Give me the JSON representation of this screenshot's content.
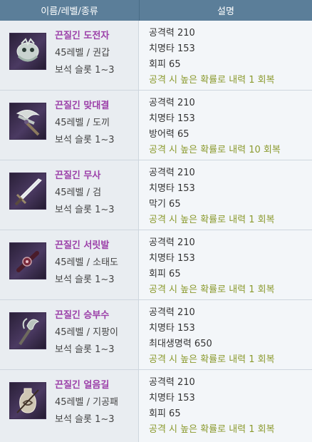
{
  "header": {
    "col_item": "이름/레벨/종류",
    "col_desc": "설명"
  },
  "items": [
    {
      "name": "끈질긴 도전자",
      "level_type": "45레벨 / 권갑",
      "slots": "보석 슬롯 1~3",
      "stats": [
        "공격력 210",
        "치명타 153",
        "회피 65"
      ],
      "effect": "공격 시 높은 확률로 내력 1 회복",
      "icon": "gauntlet-icon"
    },
    {
      "name": "끈질긴 맞대결",
      "level_type": "45레벨 / 도끼",
      "slots": "보석 슬롯 1~3",
      "stats": [
        "공격력 210",
        "치명타 153",
        "방어력 65"
      ],
      "effect": "공격 시 높은 확률로 내력 10 회복",
      "icon": "axe-icon"
    },
    {
      "name": "끈질긴 무사",
      "level_type": "45레벨 / 검",
      "slots": "보석 슬롯 1~3",
      "stats": [
        "공격력 210",
        "치명타 153",
        "막기 65"
      ],
      "effect": "공격 시 높은 확률로 내력 1 회복",
      "icon": "sword-icon"
    },
    {
      "name": "끈질긴 서릿발",
      "level_type": "45레벨 / 소태도",
      "slots": "보석 슬롯 1~3",
      "stats": [
        "공격력 210",
        "치명타 153",
        "회피 65"
      ],
      "effect": "공격 시 높은 확률로 내력 1 회복",
      "icon": "dagger-icon"
    },
    {
      "name": "끈질긴 승부수",
      "level_type": "45레벨 / 지팡이",
      "slots": "보석 슬롯 1~3",
      "stats": [
        "공격력 210",
        "치명타 153",
        "최대생명력 650"
      ],
      "effect": "공격 시 높은 확률로 내력 1 회복",
      "icon": "staff-icon"
    },
    {
      "name": "끈질긴 얼음길",
      "level_type": "45레벨 / 기공패",
      "slots": "보석 슬롯 1~3",
      "stats": [
        "공격력 210",
        "치명타 153",
        "회피 65"
      ],
      "effect": "공격 시 높은 확률로 내력 1 회복",
      "icon": "talisman-icon"
    }
  ]
}
